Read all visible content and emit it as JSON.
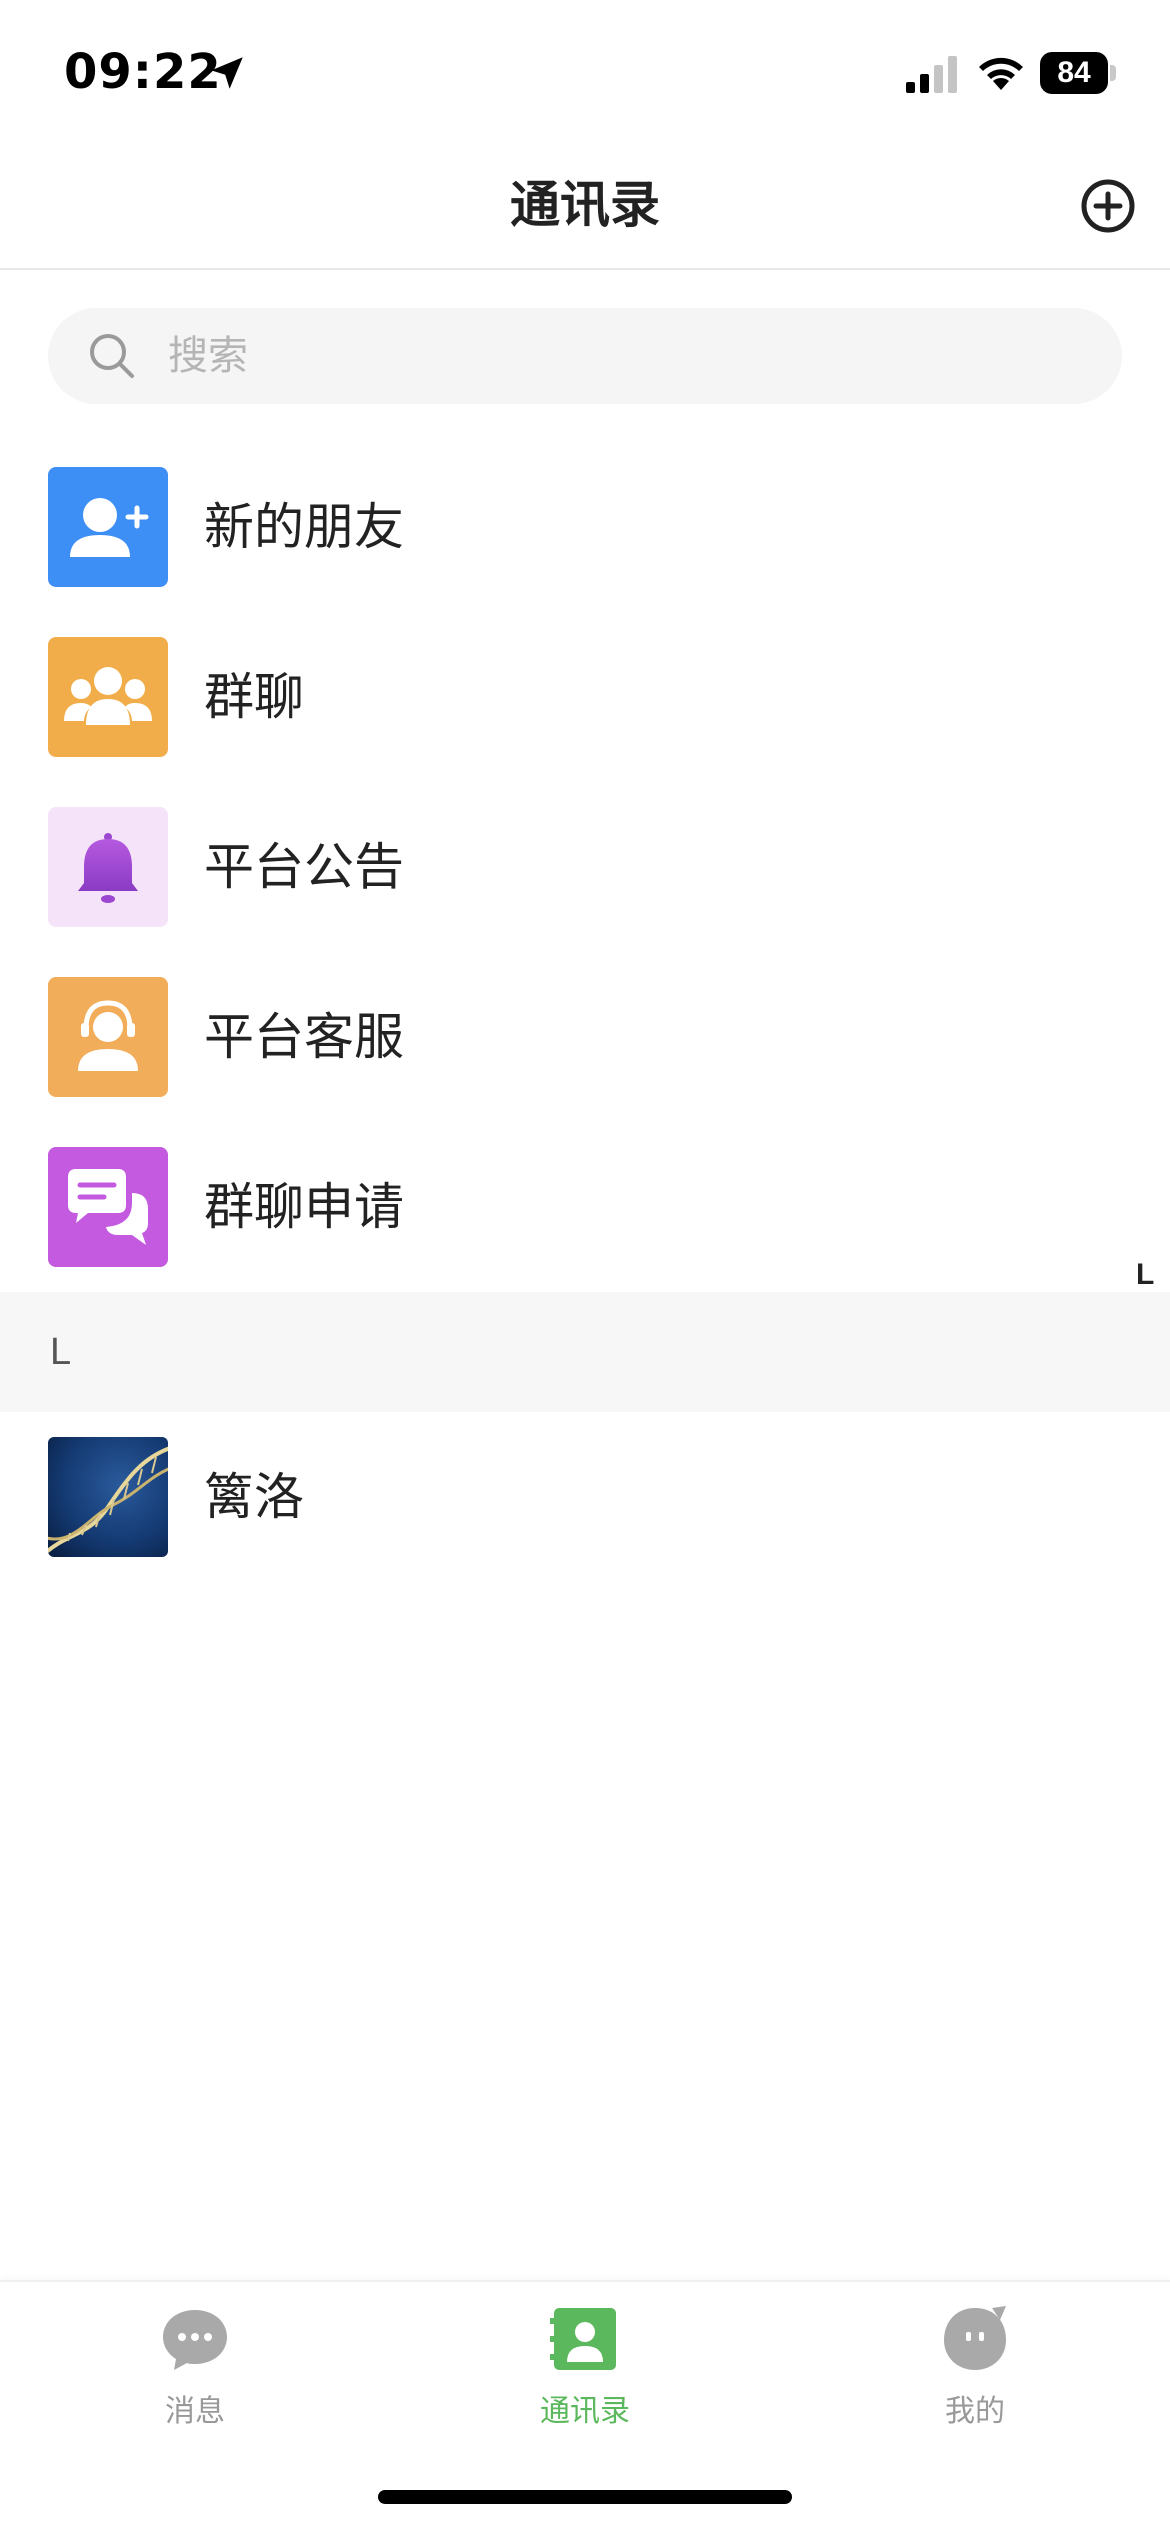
{
  "status_bar": {
    "time": "09:22",
    "battery": "84"
  },
  "header": {
    "title": "通讯录"
  },
  "search": {
    "placeholder": "搜索",
    "value": ""
  },
  "menu": [
    {
      "label": "新的朋友",
      "icon": "add-friend-icon",
      "color": "#3d8ff5"
    },
    {
      "label": "群聊",
      "icon": "group-chat-icon",
      "color": "#f2ad4b"
    },
    {
      "label": "平台公告",
      "icon": "bell-icon",
      "color": "#f5e3fa"
    },
    {
      "label": "平台客服",
      "icon": "customer-service-icon",
      "color": "#f2ad5a"
    },
    {
      "label": "群聊申请",
      "icon": "chat-request-icon",
      "color": "#c35ae0"
    }
  ],
  "index_bar": {
    "letters": [
      "L"
    ]
  },
  "contacts": [
    {
      "letter": "L",
      "items": [
        {
          "name": "篱洛",
          "avatar": "dna-avatar"
        }
      ]
    }
  ],
  "tab_bar": {
    "tabs": [
      {
        "label": "消息",
        "icon": "chat-bubble-icon",
        "active": false
      },
      {
        "label": "通讯录",
        "icon": "contacts-book-icon",
        "active": true
      },
      {
        "label": "我的",
        "icon": "profile-face-icon",
        "active": false
      }
    ],
    "active_color": "#5cb85c",
    "inactive_color": "#999999"
  }
}
